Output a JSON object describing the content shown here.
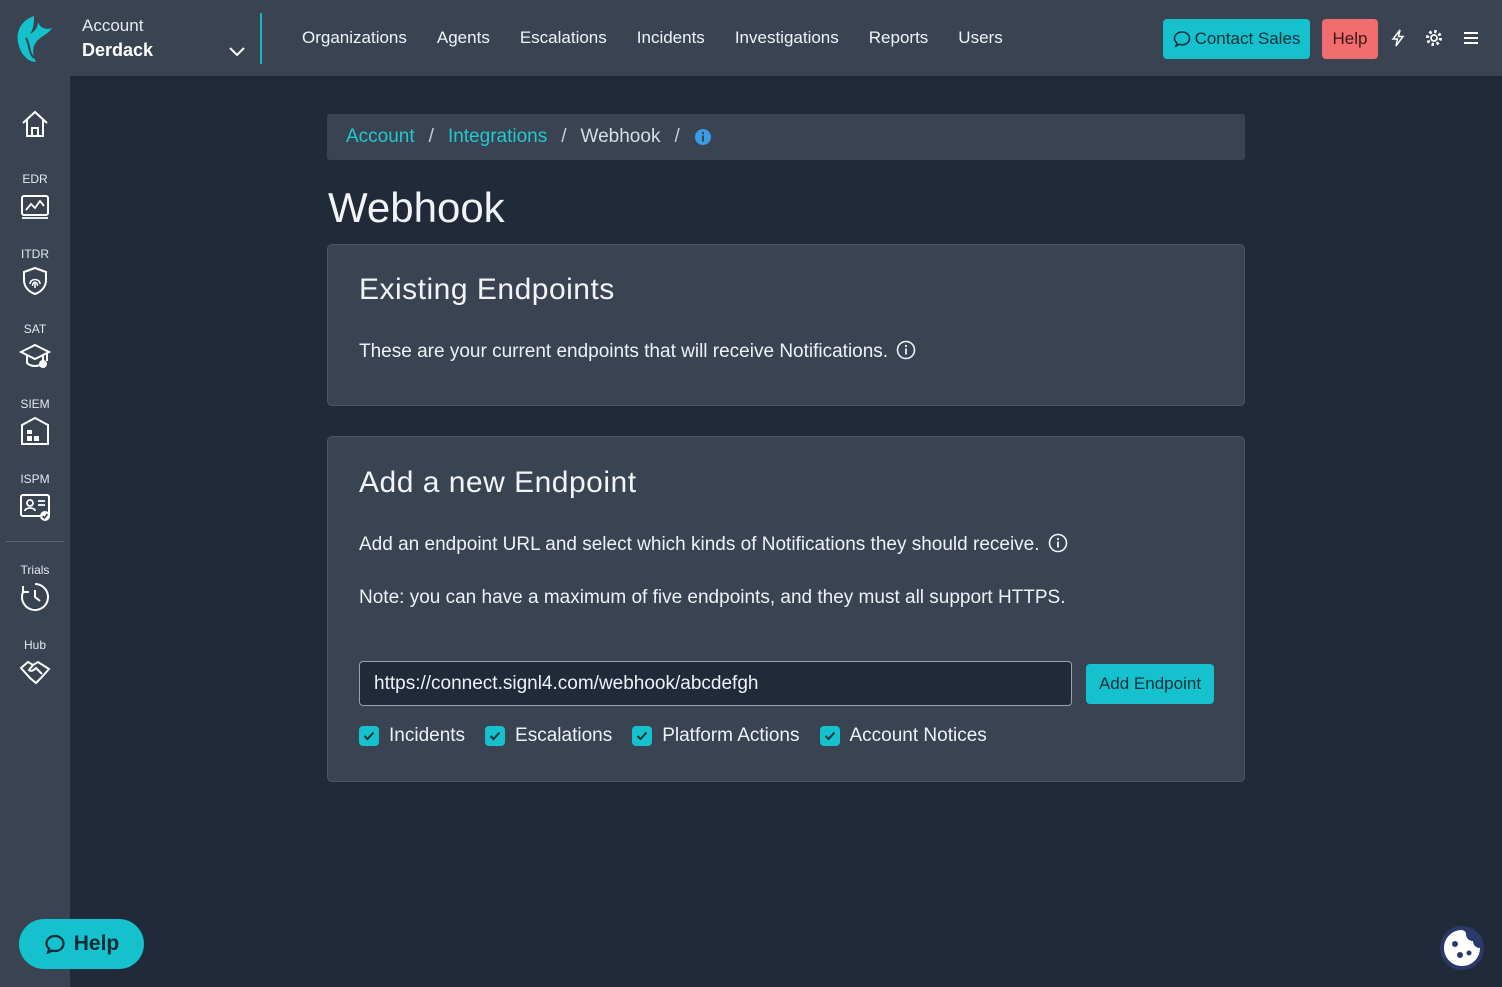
{
  "header": {
    "account_label": "Account",
    "account_name": "Derdack",
    "nav": [
      "Organizations",
      "Agents",
      "Escalations",
      "Incidents",
      "Investigations",
      "Reports",
      "Users"
    ],
    "contact_sales": "Contact Sales",
    "help": "Help",
    "icons": [
      "bolt-icon",
      "gear-icon",
      "menu-icon"
    ]
  },
  "sidebar": {
    "items": [
      {
        "label": "",
        "icon": "home-icon"
      },
      {
        "label": "EDR",
        "icon": "chart-icon"
      },
      {
        "label": "ITDR",
        "icon": "fingerprint-shield-icon"
      },
      {
        "label": "SAT",
        "icon": "graduation-cap-icon"
      },
      {
        "label": "SIEM",
        "icon": "building-icon"
      },
      {
        "label": "ISPM",
        "icon": "id-card-icon"
      },
      {
        "label": "Trials",
        "icon": "clock-icon"
      },
      {
        "label": "Hub",
        "icon": "handshake-icon"
      }
    ]
  },
  "breadcrumb": {
    "items": [
      "Account",
      "Integrations",
      "Webhook"
    ],
    "separator": "/"
  },
  "page": {
    "title": "Webhook"
  },
  "existing": {
    "heading": "Existing Endpoints",
    "description": "These are your current endpoints that will receive Notifications."
  },
  "add": {
    "heading": "Add a new Endpoint",
    "description": "Add an endpoint URL and select which kinds of Notifications they should receive.",
    "note": "Note: you can have a maximum of five endpoints, and they must all support HTTPS.",
    "url_value": "https://connect.signl4.com/webhook/abcdefgh",
    "button": "Add Endpoint",
    "checkboxes": [
      {
        "label": "Incidents",
        "checked": true
      },
      {
        "label": "Escalations",
        "checked": true
      },
      {
        "label": "Platform Actions",
        "checked": true
      },
      {
        "label": "Account Notices",
        "checked": true
      }
    ]
  },
  "floating_help": "Help",
  "colors": {
    "accent": "#14c1cd",
    "help_red": "#f26d6d",
    "bg": "#212a39",
    "panel": "#3a4351"
  }
}
